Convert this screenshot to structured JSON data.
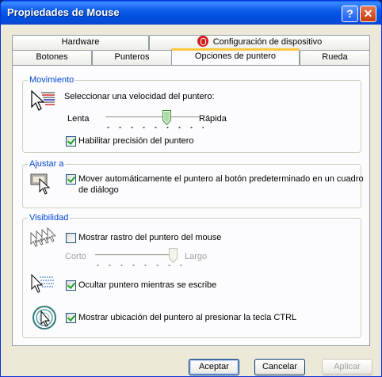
{
  "window": {
    "title": "Propiedades de Mouse",
    "help_glyph": "?",
    "close_glyph": "✕"
  },
  "tabs": {
    "back_row": [
      "Hardware",
      "Configuración de dispositivo"
    ],
    "front_row": [
      "Botones",
      "Punteros",
      "Opciones de puntero",
      "Rueda"
    ],
    "active": "Opciones de puntero"
  },
  "movimiento": {
    "legend": "Movimiento",
    "prompt": "Seleccionar una velocidad del puntero:",
    "slow_label": "Lenta",
    "fast_label": "Rápida",
    "speed_level": 0.67,
    "precision_label": "Habilitar precisión del puntero",
    "precision_checked": true
  },
  "ajustar": {
    "legend": "Ajustar a",
    "snap_label_line1": "Mover automáticamente el puntero al botón predeterminado en un cuadro",
    "snap_label_line2": "de diálogo",
    "snap_checked": true
  },
  "visibilidad": {
    "legend": "Visibilidad",
    "trails_label": "Mostrar rastro del puntero del mouse",
    "trails_checked": false,
    "short_label": "Corto",
    "long_label": "Largo",
    "trail_level": 1.0,
    "hide_label": "Ocultar puntero mientras se escribe",
    "hide_checked": true,
    "ctrl_label": "Mostrar ubicación del puntero al presionar la tecla CTRL",
    "ctrl_checked": true
  },
  "buttons": {
    "ok": "Aceptar",
    "cancel": "Cancelar",
    "apply": "Aplicar"
  },
  "colors": {
    "accent": "#0046d5",
    "titlebar": "#0054e3",
    "tab_highlight": "#ffc73c"
  }
}
